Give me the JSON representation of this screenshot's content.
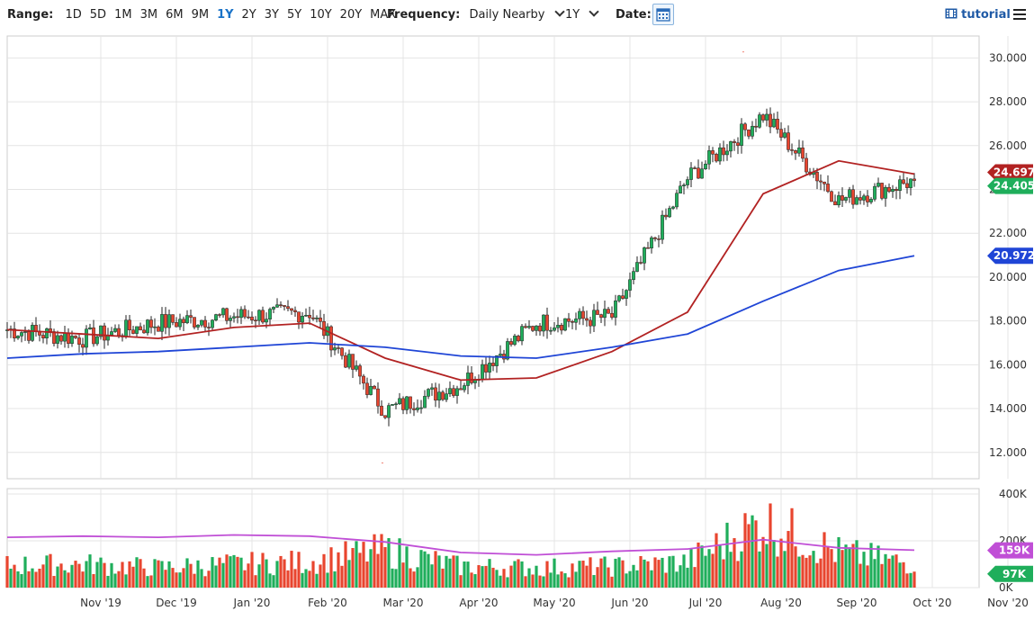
{
  "toolbar": {
    "range_label": "Range:",
    "ranges": [
      "1D",
      "5D",
      "1M",
      "3M",
      "6M",
      "9M",
      "1Y",
      "2Y",
      "3Y",
      "5Y",
      "10Y",
      "20Y",
      "MAX"
    ],
    "active_range": "1Y",
    "frequency_label": "Frequency:",
    "frequency_value": "Daily Nearby",
    "period_value": "1Y",
    "date_label": "Date:",
    "tutorial_label": "tutorial"
  },
  "colors": {
    "up": "#1fae5b",
    "down": "#e8452f",
    "ma_short": "#b22222",
    "ma_long": "#1f45d6",
    "vol_avg": "#c04fd6",
    "last_price_bg": "#1fae5b",
    "ma_long_badge": "#1f45d6",
    "vol_avg_badge": "#c04fd6",
    "vol_last_badge": "#1fae5b"
  },
  "chart_data": [
    {
      "type": "candlestick",
      "title": "",
      "x_ticks": [
        "Nov '19",
        "Dec '19",
        "Jan '20",
        "Feb '20",
        "Mar '20",
        "Apr '20",
        "May '20",
        "Jun '20",
        "Jul '20",
        "Aug '20",
        "Sep '20",
        "Oct '20",
        "Nov '20"
      ],
      "y_ticks": [
        "12.000",
        "14.000",
        "16.000",
        "18.000",
        "20.000",
        "22.000",
        "24.000",
        "26.000",
        "28.000",
        "30.000"
      ],
      "ylim": [
        10.8,
        31.0
      ],
      "grid": true,
      "monthly": [
        {
          "month": "Oct '19",
          "close": 17.6
        },
        {
          "month": "Nov '19",
          "close": 17.2
        },
        {
          "month": "Dec '19",
          "close": 17.9
        },
        {
          "month": "Jan '20",
          "close": 18.2
        },
        {
          "month": "Feb '20",
          "close": 18.4
        },
        {
          "month": "Mar '20",
          "close": 13.9
        },
        {
          "month": "Apr '20",
          "close": 15.1
        },
        {
          "month": "May '20",
          "close": 17.9
        },
        {
          "month": "Jun '20",
          "close": 18.2
        },
        {
          "month": "Jul '20",
          "close": 24.5
        },
        {
          "month": "Aug '20",
          "close": 27.4
        },
        {
          "month": "Sep '20",
          "close": 23.5
        },
        {
          "month": "Oct '20",
          "close": 24.405
        }
      ],
      "high_marker": 30.1,
      "low_marker": 11.6,
      "last_price": "24.405",
      "ma_short_label": "24.697",
      "ma_long_label": "20.972",
      "ma_short_series": [
        {
          "month": "Oct '19",
          "value": 17.6
        },
        {
          "month": "Nov '19",
          "value": 17.4
        },
        {
          "month": "Dec '19",
          "value": 17.2
        },
        {
          "month": "Jan '20",
          "value": 17.7
        },
        {
          "month": "Feb '20",
          "value": 17.9
        },
        {
          "month": "Mar '20",
          "value": 16.3
        },
        {
          "month": "Apr '20",
          "value": 15.3
        },
        {
          "month": "May '20",
          "value": 15.4
        },
        {
          "month": "Jun '20",
          "value": 16.6
        },
        {
          "month": "Jul '20",
          "value": 18.4
        },
        {
          "month": "Aug '20",
          "value": 23.8
        },
        {
          "month": "Sep '20",
          "value": 25.3
        },
        {
          "month": "Oct '20",
          "value": 24.7
        }
      ],
      "ma_long_series": [
        {
          "month": "Oct '19",
          "value": 16.3
        },
        {
          "month": "Nov '19",
          "value": 16.5
        },
        {
          "month": "Dec '19",
          "value": 16.6
        },
        {
          "month": "Jan '20",
          "value": 16.8
        },
        {
          "month": "Feb '20",
          "value": 17.0
        },
        {
          "month": "Mar '20",
          "value": 16.8
        },
        {
          "month": "Apr '20",
          "value": 16.4
        },
        {
          "month": "May '20",
          "value": 16.3
        },
        {
          "month": "Jun '20",
          "value": 16.8
        },
        {
          "month": "Jul '20",
          "value": 17.4
        },
        {
          "month": "Aug '20",
          "value": 18.9
        },
        {
          "month": "Sep '20",
          "value": 20.3
        },
        {
          "month": "Oct '20",
          "value": 20.97
        }
      ]
    },
    {
      "type": "bar",
      "title": "",
      "y_ticks": [
        "0K",
        "200K",
        "400K"
      ],
      "ylim": [
        0,
        400000
      ],
      "vol_avg_label": "159K",
      "vol_last_label": "97K",
      "monthly_avg_volume": [
        {
          "month": "Oct '19",
          "value": 95000
        },
        {
          "month": "Nov '19",
          "value": 100000
        },
        {
          "month": "Dec '19",
          "value": 85000
        },
        {
          "month": "Jan '20",
          "value": 100000
        },
        {
          "month": "Feb '20",
          "value": 110000
        },
        {
          "month": "Mar '20",
          "value": 160000
        },
        {
          "month": "Apr '20",
          "value": 90000
        },
        {
          "month": "May '20",
          "value": 85000
        },
        {
          "month": "Jun '20",
          "value": 90000
        },
        {
          "month": "Jul '20",
          "value": 110000
        },
        {
          "month": "Aug '20",
          "value": 280000
        },
        {
          "month": "Sep '20",
          "value": 150000
        },
        {
          "month": "Oct '20",
          "value": 100000
        }
      ],
      "avg_series": [
        {
          "month": "Oct '19",
          "value": 215000
        },
        {
          "month": "Nov '19",
          "value": 220000
        },
        {
          "month": "Dec '19",
          "value": 215000
        },
        {
          "month": "Jan '20",
          "value": 225000
        },
        {
          "month": "Feb '20",
          "value": 220000
        },
        {
          "month": "Mar '20",
          "value": 195000
        },
        {
          "month": "Apr '20",
          "value": 150000
        },
        {
          "month": "May '20",
          "value": 140000
        },
        {
          "month": "Jun '20",
          "value": 155000
        },
        {
          "month": "Jul '20",
          "value": 165000
        },
        {
          "month": "Aug '20",
          "value": 205000
        },
        {
          "month": "Sep '20",
          "value": 170000
        },
        {
          "month": "Oct '20",
          "value": 160000
        }
      ]
    }
  ]
}
